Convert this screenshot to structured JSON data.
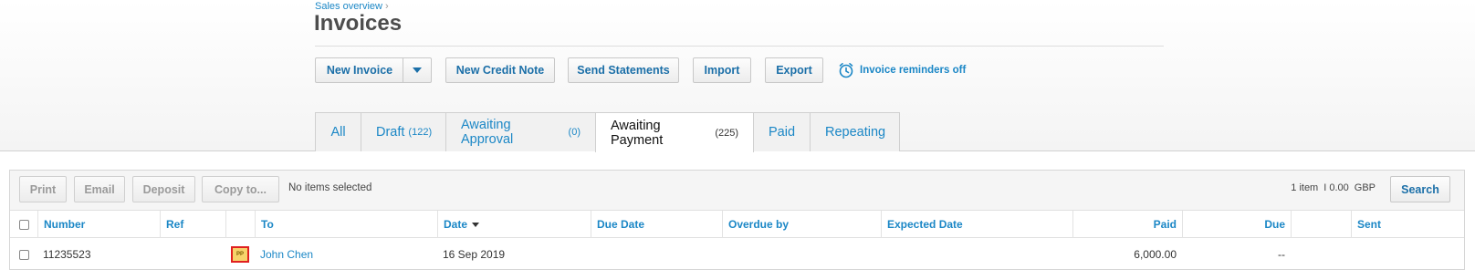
{
  "breadcrumb": {
    "label": "Sales overview",
    "separator": "›"
  },
  "page": {
    "title": "Invoices"
  },
  "actions": {
    "new_invoice": "New Invoice",
    "new_credit_note": "New Credit Note",
    "send_statements": "Send Statements",
    "import": "Import",
    "export": "Export",
    "reminders": "Invoice reminders off"
  },
  "tabs": [
    {
      "label": "All",
      "count": ""
    },
    {
      "label": "Draft",
      "count": "(122)"
    },
    {
      "label": "Awaiting Approval",
      "count": "(0)"
    },
    {
      "label": "Awaiting Payment",
      "count": "(225)"
    },
    {
      "label": "Paid",
      "count": ""
    },
    {
      "label": "Repeating",
      "count": ""
    }
  ],
  "active_tab": "Awaiting Payment",
  "toolbar": {
    "print": "Print",
    "email": "Email",
    "deposit": "Deposit",
    "copy_to": "Copy to...",
    "selection_status": "No items selected",
    "item_count": "1 item",
    "total": "I 0.00",
    "currency": "GBP",
    "search": "Search"
  },
  "table": {
    "columns": {
      "number": "Number",
      "ref": "Ref",
      "to": "To",
      "date": "Date",
      "due_date": "Due Date",
      "overdue_by": "Overdue by",
      "expected_date": "Expected Date",
      "paid": "Paid",
      "due": "Due",
      "sent": "Sent"
    },
    "rows": [
      {
        "number": "11235523",
        "ref": "",
        "badge": "PP",
        "to": "John Chen",
        "date": "16 Sep 2019",
        "due_date": "",
        "overdue_by": "",
        "expected_date": "",
        "paid": "6,000.00",
        "due": "--",
        "sent": ""
      }
    ]
  },
  "colors": {
    "link": "#1b87c6",
    "button_text": "#1b6fa8",
    "badge_border": "#e02020",
    "badge_fill": "#f7d36b"
  },
  "icons": {
    "reminders": "alarm-clock-icon",
    "sort": "sort-descending-icon",
    "dropdown": "chevron-down-icon"
  }
}
